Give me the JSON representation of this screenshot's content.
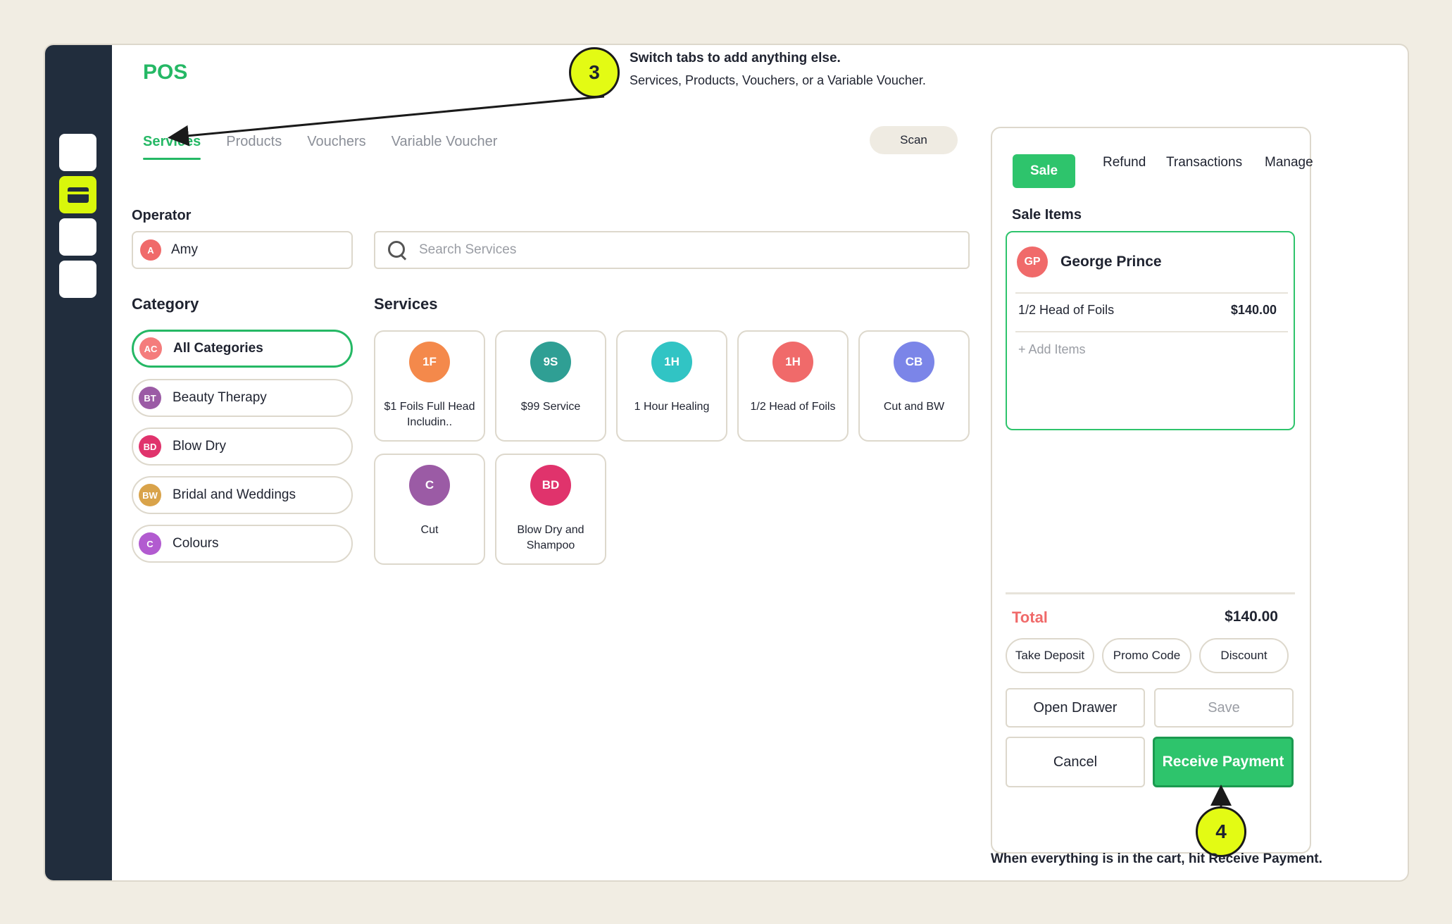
{
  "app": {
    "title": "POS"
  },
  "rail": {
    "items": [
      "blank",
      "card-icon",
      "blank",
      "blank"
    ],
    "active_index": 1
  },
  "tabs": [
    {
      "label": "Services",
      "active": true
    },
    {
      "label": "Products",
      "active": false
    },
    {
      "label": "Vouchers",
      "active": false
    },
    {
      "label": "Variable Voucher",
      "active": false
    }
  ],
  "scan_label": "Scan",
  "operator": {
    "label": "Operator",
    "initial": "A",
    "name": "Amy",
    "color": "#f06a6a"
  },
  "search": {
    "placeholder": "Search Services",
    "icon": "search-icon"
  },
  "category": {
    "heading": "Category",
    "items": [
      {
        "initials": "AC",
        "label": "All Categories",
        "color": "#f47c7c",
        "active": true
      },
      {
        "initials": "BT",
        "label": "Beauty Therapy",
        "color": "#9b5ba5",
        "active": false
      },
      {
        "initials": "BD",
        "label": "Blow Dry",
        "color": "#e0336c",
        "active": false
      },
      {
        "initials": "BW",
        "label": "Bridal and Weddings",
        "color": "#d9a34a",
        "active": false
      },
      {
        "initials": "C",
        "label": "Colours",
        "color": "#b25bd0",
        "active": false
      }
    ]
  },
  "services": {
    "heading": "Services",
    "items": [
      {
        "initials": "1F",
        "name": "$1 Foils Full Head Includin..",
        "color": "#f4894b"
      },
      {
        "initials": "9S",
        "name": "$99 Service",
        "color": "#2f9f94"
      },
      {
        "initials": "1H",
        "name": "1 Hour Healing",
        "color": "#31c4c4"
      },
      {
        "initials": "1H",
        "name": "1/2 Head of Foils",
        "color": "#f06a6a"
      },
      {
        "initials": "CB",
        "name": "Cut and BW",
        "color": "#7b85e8"
      },
      {
        "initials": "C",
        "name": "Cut",
        "color": "#9b5ba5"
      },
      {
        "initials": "BD",
        "name": "Blow Dry and Shampoo",
        "color": "#e0336c"
      }
    ]
  },
  "panel": {
    "tabs": [
      "Sale",
      "Refund",
      "Transactions",
      "Manage"
    ],
    "active_tab": "Sale",
    "sale_items_heading": "Sale Items",
    "customer": {
      "initials": "GP",
      "name": "George Prince",
      "color": "#f06a6a"
    },
    "line_items": [
      {
        "name": "1/2 Head of Foils",
        "price": "$140.00"
      }
    ],
    "add_items": "+ Add Items",
    "total_label": "Total",
    "total_value": "$140.00",
    "pills": [
      "Take Deposit",
      "Promo Code",
      "Discount"
    ],
    "open_drawer": "Open Drawer",
    "save": "Save",
    "cancel": "Cancel",
    "receive_payment": "Receive Payment"
  },
  "callouts": {
    "step3": {
      "number": "3",
      "title": "Switch tabs to add anything else.",
      "text": "Services, Products, Vouchers, or a Variable Voucher."
    },
    "step4": {
      "number": "4",
      "text": "When everything is in the cart, hit Receive Payment."
    }
  },
  "colors": {
    "accent": "#2ec46c",
    "highlight": "#e3fb14",
    "rail": "#212d3d",
    "total": "#f06a6a"
  }
}
